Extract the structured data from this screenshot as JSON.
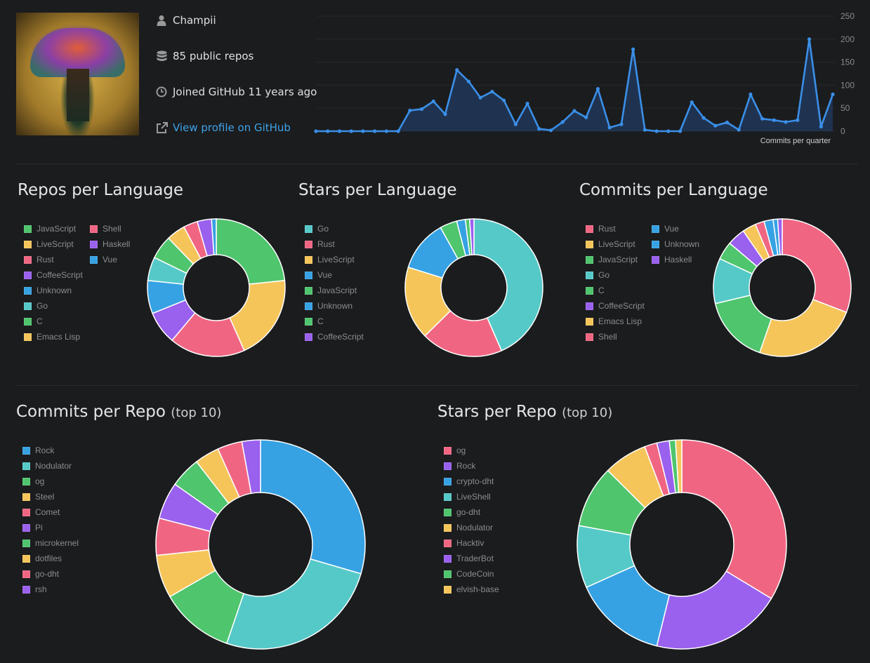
{
  "profile": {
    "username": "Champii",
    "repos_text": "85 public repos",
    "joined_text": "Joined GitHub 11 years ago",
    "profile_link": "View profile on GitHub"
  },
  "colors": {
    "green": "#4fc56e",
    "yellow": "#f5c55a",
    "red": "#f06682",
    "purple": "#9a60ee",
    "blue": "#36a2e3",
    "teal": "#55c9c8",
    "line": "#3a8fe8",
    "area": "#1f3350"
  },
  "chart_data": [
    {
      "type": "area",
      "id": "commits-per-quarter",
      "title": "",
      "xlabel": "Commits per quarter",
      "ylabel": "",
      "ylim": [
        0,
        250
      ],
      "yticks": [
        0,
        50,
        100,
        150,
        200,
        250
      ],
      "x": [
        1,
        2,
        3,
        4,
        5,
        6,
        7,
        8,
        9,
        10,
        11,
        12,
        13,
        14,
        15,
        16,
        17,
        18,
        19,
        20,
        21,
        22,
        23,
        24,
        25,
        26,
        27,
        28,
        29,
        30,
        31,
        32,
        33,
        34,
        35,
        36,
        37,
        38,
        39,
        40,
        41,
        42,
        43,
        44,
        45,
        46,
        47,
        48
      ],
      "values": [
        0,
        0,
        0,
        0,
        0,
        0,
        0,
        0,
        45,
        48,
        65,
        37,
        133,
        108,
        73,
        86,
        67,
        15,
        60,
        5,
        2,
        20,
        44,
        30,
        92,
        8,
        15,
        178,
        3,
        0,
        0,
        0,
        63,
        29,
        12,
        19,
        3,
        80,
        27,
        24,
        20,
        24,
        200,
        10,
        80
      ],
      "grid": true
    },
    {
      "type": "pie",
      "id": "repos-per-language",
      "title": "Repos per Language",
      "categories": [
        "JavaScript",
        "LiveScript",
        "Rust",
        "CoffeeScript",
        "Unknown",
        "Go",
        "C",
        "Emacs Lisp",
        "Shell",
        "Haskell",
        "Vue"
      ],
      "values": [
        21,
        18,
        16,
        7,
        7,
        5,
        5,
        4,
        3,
        3,
        1
      ],
      "colors": [
        "#4fc56e",
        "#f5c55a",
        "#f06682",
        "#9a60ee",
        "#36a2e3",
        "#55c9c8",
        "#4fc56e",
        "#f5c55a",
        "#f06682",
        "#9a60ee",
        "#36a2e3"
      ]
    },
    {
      "type": "pie",
      "id": "stars-per-language",
      "title": "Stars per Language",
      "categories": [
        "Go",
        "Rust",
        "LiveScript",
        "Vue",
        "JavaScript",
        "Unknown",
        "C",
        "CoffeeScript"
      ],
      "values": [
        43,
        19,
        17,
        12,
        4,
        2,
        1,
        1
      ],
      "colors": [
        "#55c9c8",
        "#f06682",
        "#f5c55a",
        "#36a2e3",
        "#4fc56e",
        "#36a2e3",
        "#4fc56e",
        "#9a60ee"
      ]
    },
    {
      "type": "pie",
      "id": "commits-per-language",
      "title": "Commits per Language",
      "categories": [
        "Rust",
        "LiveScript",
        "JavaScript",
        "Go",
        "C",
        "CoffeeScript",
        "Emacs Lisp",
        "Shell",
        "Vue",
        "Unknown",
        "Haskell"
      ],
      "values": [
        29,
        23,
        15,
        10,
        4,
        4,
        3,
        2,
        2,
        1,
        1
      ],
      "colors": [
        "#f06682",
        "#f5c55a",
        "#4fc56e",
        "#55c9c8",
        "#4fc56e",
        "#9a60ee",
        "#f5c55a",
        "#f06682",
        "#36a2e3",
        "#36a2e3",
        "#9a60ee"
      ]
    },
    {
      "type": "pie",
      "id": "commits-per-repo",
      "title": "Commits per Repo",
      "subtitle": "(top 10)",
      "categories": [
        "Rock",
        "Nodulator",
        "og",
        "Steel",
        "Comet",
        "Pi",
        "microkernel",
        "dotfiles",
        "go-dht",
        "rsh"
      ],
      "values": [
        31,
        27,
        12,
        7,
        6,
        6,
        5,
        4,
        4,
        3
      ],
      "colors": [
        "#36a2e3",
        "#55c9c8",
        "#4fc56e",
        "#f5c55a",
        "#f06682",
        "#9a60ee",
        "#4fc56e",
        "#f5c55a",
        "#f06682",
        "#9a60ee"
      ]
    },
    {
      "type": "pie",
      "id": "stars-per-repo",
      "title": "Stars per Repo",
      "subtitle": "(top 10)",
      "categories": [
        "og",
        "Rock",
        "crypto-dht",
        "LiveShell",
        "go-dht",
        "Nodulator",
        "Hacktiv",
        "TraderBot",
        "CodeCoin",
        "elvish-base"
      ],
      "values": [
        35,
        21,
        15,
        10,
        10,
        7,
        2,
        2,
        1,
        1
      ],
      "colors": [
        "#f06682",
        "#9a60ee",
        "#36a2e3",
        "#55c9c8",
        "#4fc56e",
        "#f5c55a",
        "#f06682",
        "#9a60ee",
        "#4fc56e",
        "#f5c55a"
      ]
    }
  ]
}
